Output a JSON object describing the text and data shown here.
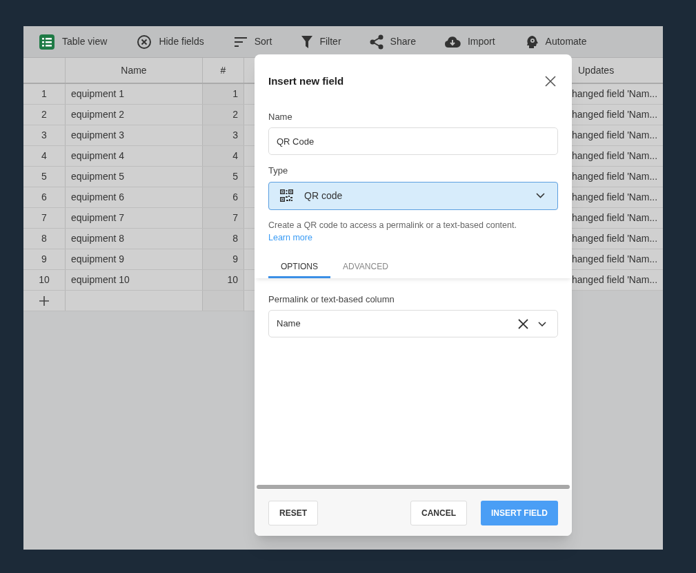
{
  "toolbar": [
    {
      "label": "Table view",
      "kind": "table"
    },
    {
      "label": "Hide fields",
      "kind": "hide"
    },
    {
      "label": "Sort",
      "kind": "sort"
    },
    {
      "label": "Filter",
      "kind": "filter"
    },
    {
      "label": "Share",
      "kind": "share"
    },
    {
      "label": "Import",
      "kind": "import"
    },
    {
      "label": "Automate",
      "kind": "automate"
    }
  ],
  "table": {
    "columns": [
      {
        "label": "Name"
      },
      {
        "label": "#"
      },
      {
        "label": "Updates"
      }
    ],
    "rows": [
      {
        "index": "1",
        "name": "equipment 1",
        "number": "1",
        "updates": "hanged field 'Nam..."
      },
      {
        "index": "2",
        "name": "equipment 2",
        "number": "2",
        "updates": "hanged field 'Nam..."
      },
      {
        "index": "3",
        "name": "equipment 3",
        "number": "3",
        "updates": "hanged field 'Nam..."
      },
      {
        "index": "4",
        "name": "equipment 4",
        "number": "4",
        "updates": "hanged field 'Nam..."
      },
      {
        "index": "5",
        "name": "equipment 5",
        "number": "5",
        "updates": "hanged field 'Nam..."
      },
      {
        "index": "6",
        "name": "equipment 6",
        "number": "6",
        "updates": "hanged field 'Nam..."
      },
      {
        "index": "7",
        "name": "equipment 7",
        "number": "7",
        "updates": "hanged field 'Nam..."
      },
      {
        "index": "8",
        "name": "equipment 8",
        "number": "8",
        "updates": "hanged field 'Nam..."
      },
      {
        "index": "9",
        "name": "equipment 9",
        "number": "9",
        "updates": "hanged field 'Nam..."
      },
      {
        "index": "10",
        "name": "equipment 10",
        "number": "10",
        "updates": "hanged field 'Nam..."
      }
    ]
  },
  "dialog": {
    "title": "Insert new field",
    "name_field": {
      "label": "Name",
      "value": "QR Code"
    },
    "type_field": {
      "label": "Type",
      "value": "QR code"
    },
    "description": "Create a QR code to access a permalink or a text-based content.",
    "learn_more": "Learn more",
    "tabs": [
      {
        "label": "OPTIONS",
        "selected": true
      },
      {
        "label": "ADVANCED",
        "selected": false
      }
    ],
    "column_field": {
      "label": "Permalink or text-based column",
      "value": "Name"
    },
    "buttons": [
      {
        "label": "RESET",
        "kind": "secondary"
      },
      {
        "label": "CANCEL",
        "kind": "secondary"
      },
      {
        "label": "INSERT FIELD",
        "kind": "primary"
      }
    ]
  }
}
